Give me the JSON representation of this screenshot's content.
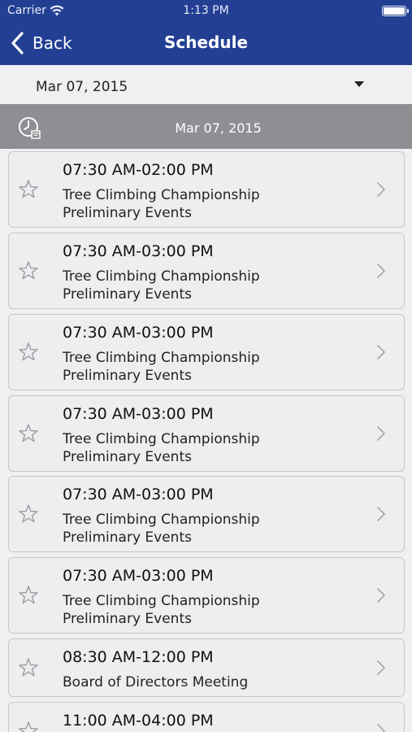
{
  "status_bar": {
    "carrier": "Carrier",
    "time": "1:13 PM"
  },
  "nav": {
    "back_label": "Back",
    "title": "Schedule"
  },
  "date_picker": {
    "selected": "Mar 07, 2015"
  },
  "section_header": {
    "date": "Mar 07, 2015"
  },
  "events": [
    {
      "time": "07:30 AM-02:00 PM",
      "title_line1": "Tree Climbing Championship",
      "title_line2": "Preliminary Events"
    },
    {
      "time": "07:30 AM-03:00 PM",
      "title_line1": "Tree Climbing Championship",
      "title_line2": "Preliminary Events"
    },
    {
      "time": "07:30 AM-03:00 PM",
      "title_line1": "Tree Climbing Championship",
      "title_line2": "Preliminary Events"
    },
    {
      "time": "07:30 AM-03:00 PM",
      "title_line1": "Tree Climbing Championship",
      "title_line2": "Preliminary Events"
    },
    {
      "time": "07:30 AM-03:00 PM",
      "title_line1": "Tree Climbing Championship",
      "title_line2": "Preliminary Events"
    },
    {
      "time": "07:30 AM-03:00 PM",
      "title_line1": "Tree Climbing Championship",
      "title_line2": "Preliminary Events"
    },
    {
      "time": "08:30 AM-12:00 PM",
      "title_line1": "Board of Directors Meeting",
      "title_line2": ""
    },
    {
      "time": "11:00 AM-04:00 PM",
      "title_line1": "",
      "title_line2": ""
    }
  ],
  "colors": {
    "nav_bar": "#233f94",
    "section_header": "#8e8e93",
    "card_bg": "#eeeef0"
  },
  "icons": {
    "back": "chevron-left-icon",
    "star": "star-outline-icon",
    "row": "chevron-right-icon",
    "section": "clock-calendar-icon"
  }
}
